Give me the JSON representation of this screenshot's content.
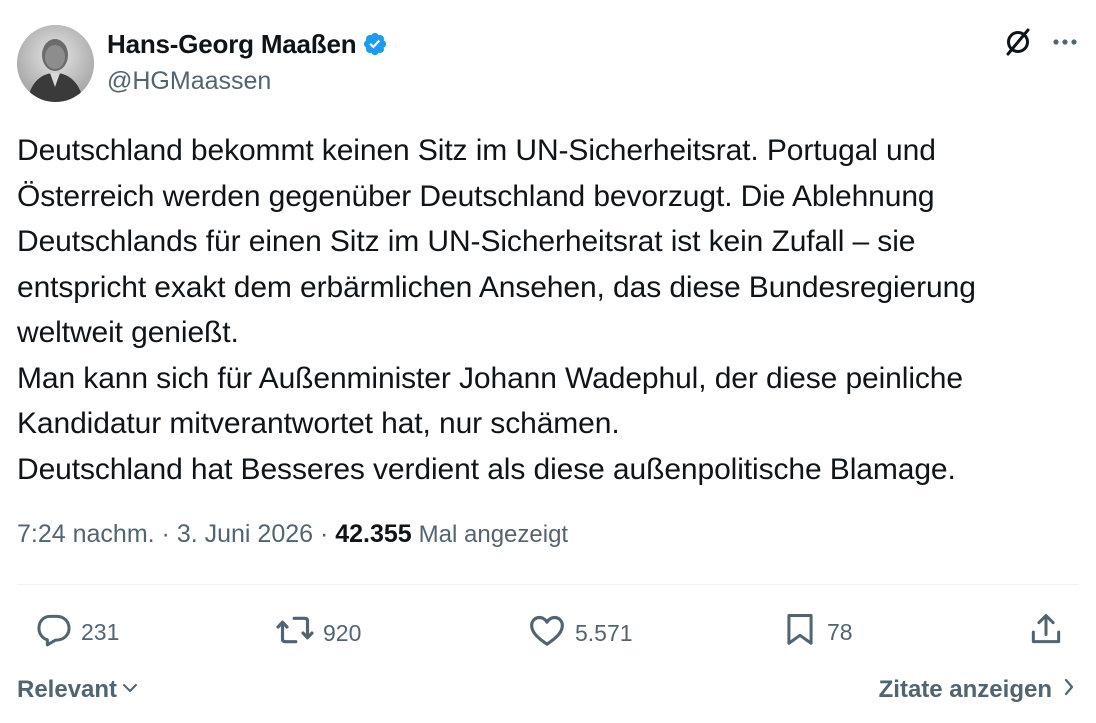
{
  "author": {
    "name": "Hans-Georg Maaßen",
    "handle": "@HGMaassen",
    "verified": true,
    "verified_color": "#1d9bf0"
  },
  "tweet": {
    "text": "Deutschland bekommt keinen Sitz im UN-Sicherheitsrat. Portugal und\nÖsterreich werden gegenüber Deutschland bevorzugt. Die Ablehnung\nDeutschlands für einen Sitz im UN-Sicherheitsrat ist kein Zufall – sie\nentspricht exakt dem erbärmlichen Ansehen, das diese Bundesregierung\nweltweit genießt.\nMan kann sich für Außenminister Johann Wadephul, der diese peinliche\nKandidatur mitverantwortet hat, nur schämen.\nDeutschland hat Besseres verdient als diese außenpolitische Blamage.",
    "time": "7:24 nachm.",
    "separator": " · ",
    "date": "3. Juni 2026",
    "views": "42.355",
    "views_label": "Mal angezeigt"
  },
  "actions": {
    "replies": "231",
    "reposts": "920",
    "likes": "5.571",
    "bookmarks": "78"
  },
  "footer": {
    "sort_label": "Relevant",
    "quotes_label": "Zitate anzeigen"
  },
  "icons": {
    "grok": "grok-icon",
    "more": "more-icon",
    "reply": "reply-icon",
    "repost": "repost-icon",
    "like": "like-icon",
    "bookmark": "bookmark-icon",
    "share": "share-icon"
  },
  "colors": {
    "text": "#0f1419",
    "secondary": "#536471",
    "divider": "#eff3f4"
  }
}
